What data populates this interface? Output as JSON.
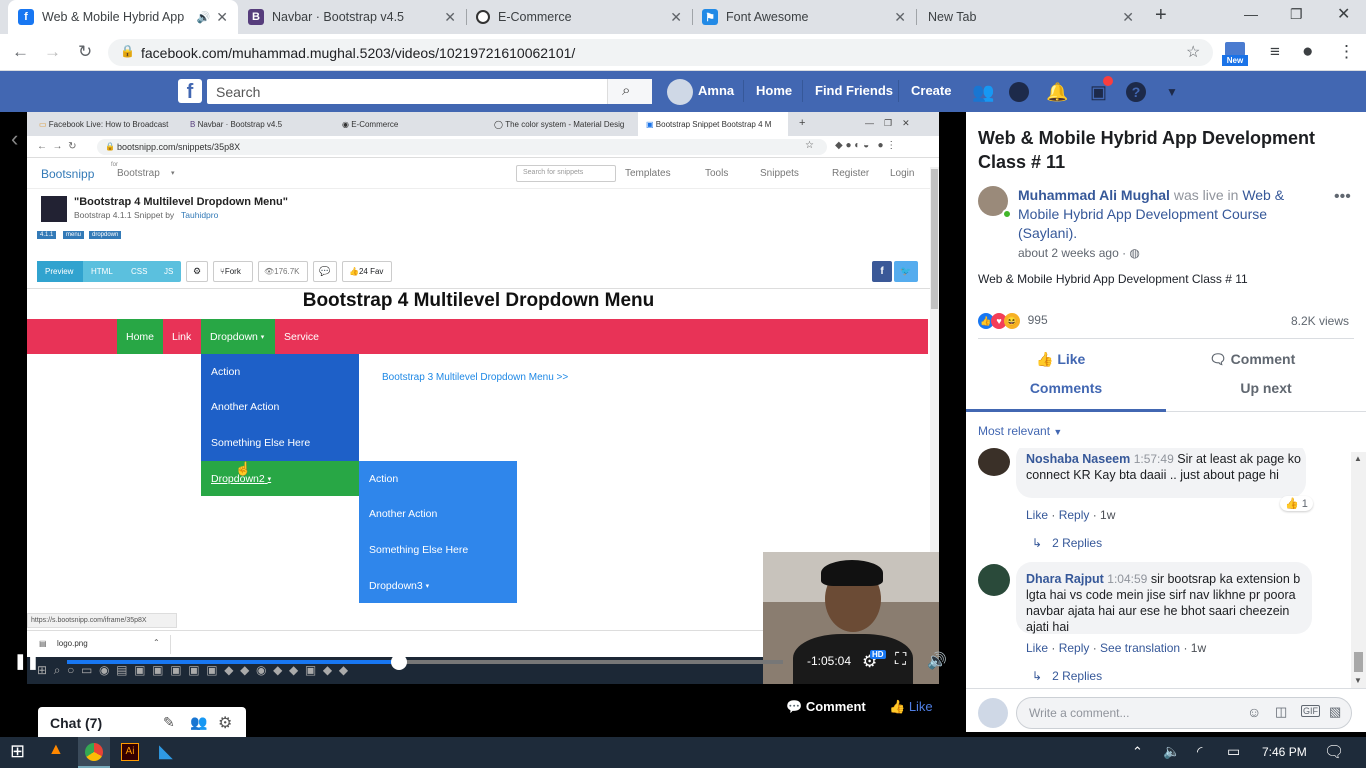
{
  "browser": {
    "tabs": [
      {
        "title": "Web & Mobile Hybrid App",
        "color": "#1877f2",
        "glyph": "f",
        "active": true
      },
      {
        "title": "Navbar · Bootstrap v4.5",
        "color": "#563d7c",
        "glyph": "B",
        "active": false
      },
      {
        "title": "E-Commerce",
        "color": "#333333",
        "glyph": "◉",
        "active": false
      },
      {
        "title": "Font Awesome",
        "color": "#228ae6",
        "glyph": "⚑",
        "active": false
      },
      {
        "title": "New Tab",
        "color": "",
        "glyph": "",
        "active": false
      }
    ],
    "url": "facebook.com/muhammad.mughal.5203/videos/10219721610062101/",
    "new_badge": "New"
  },
  "facebook": {
    "search_placeholder": "Search",
    "user": "Amna",
    "nav": [
      "Home",
      "Find Friends",
      "Create"
    ]
  },
  "inner_browser": {
    "tabs": [
      "Facebook Live: How to Broadcast",
      "Navbar · Bootstrap v4.5",
      "E-Commerce",
      "The color system - Material Desig",
      "Bootstrap Snippet Bootstrap 4 M"
    ],
    "url": "bootsnipp.com/snippets/35p8X",
    "brand": "Bootsnipp",
    "for_label": "for",
    "framework": "Bootstrap",
    "search_placeholder": "Search for snippets",
    "menu": [
      "Templates",
      "Tools",
      "Snippets",
      "Register",
      "Login"
    ],
    "snippet_title": "\"Bootstrap 4 Multilevel Dropdown Menu\"",
    "snippet_sub": "Bootstrap 4.1.1 Snippet by",
    "snippet_author": "Tauhidpro",
    "tags": [
      "4.1.1",
      "menu",
      "dropdown"
    ],
    "tool_buttons": [
      "Preview",
      "HTML",
      "CSS",
      "JS"
    ],
    "fork": "Fork",
    "views": "176.7K",
    "fav": "24 Fav",
    "page_title": "Bootstrap 4 Multilevel Dropdown Menu",
    "nav_items": [
      "Home",
      "Link",
      "Dropdown",
      "Service"
    ],
    "dropdown_items": [
      "Action",
      "Another Action",
      "Something Else Here",
      "Dropdown2"
    ],
    "sub_items": [
      "Action",
      "Another Action",
      "Something Else Here",
      "Dropdown3"
    ],
    "side_link": "Bootstrap 3 Multilevel Dropdown Menu >>",
    "status_url": "https://s.bootsnipp.com/iframe/35p8X",
    "download": "logo.png"
  },
  "video": {
    "time": "-1:05:04",
    "quality": "HD",
    "progress": 0.464
  },
  "post": {
    "title": "Web & Mobile Hybrid App Development Class # 11",
    "author": "Muhammad Ali Mughal",
    "was_live": "was live in",
    "course": "Web & Mobile Hybrid App Development Course (Saylani).",
    "time": "about 2 weeks ago ·",
    "description": "Web & Mobile Hybrid App Development Class # 11",
    "reactions": "995",
    "views": "8.2K views",
    "like": "Like",
    "comment": "Comment",
    "tab_comments": "Comments",
    "tab_up_next": "Up next",
    "sort": "Most relevant",
    "comments": [
      {
        "name": "Noshaba Naseem",
        "time": "1:57:49",
        "text": "Sir at least ak page ko connect KR Kay bta daaii .. just about page hi",
        "like": "Like",
        "reply": "Reply",
        "age": "1w",
        "likes": "1",
        "replies": "2 Replies"
      },
      {
        "name": "Dhara Rajput",
        "time": "1:04:59",
        "text": "sir bootsrap ka extension b lgta hai vs code mein jise sirf nav likhne pr poora navbar ajata hai aur ese he bhot saari cheezein ajati hai",
        "like": "Like",
        "reply": "Reply",
        "translate": "See translation",
        "age": "1w",
        "replies": "2 Replies"
      }
    ],
    "write_placeholder": "Write a comment..."
  },
  "below_video": {
    "comment": "Comment",
    "like": "Like"
  },
  "chat": {
    "label": "Chat (7)"
  },
  "taskbar": {
    "time": "7:46 PM"
  }
}
